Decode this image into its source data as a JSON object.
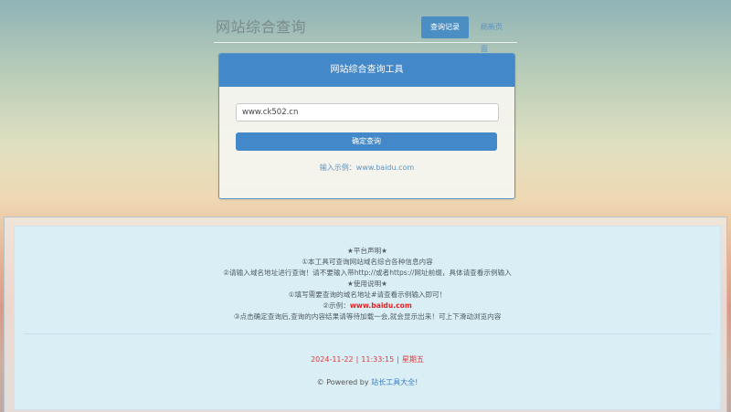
{
  "header": {
    "title": "网站综合查询",
    "history_button": "查询记录",
    "refresh_link": "刷新页面"
  },
  "panel": {
    "title": "网站综合查询工具",
    "input_value": "www.ck502.cn",
    "submit_label": "确定查询",
    "example_text": "输入示例：www.baidu.com"
  },
  "notice": {
    "lines": [
      "★平台声明★",
      "①本工具可查询网站域名综合各种信息内容",
      "②请输入域名地址进行查询！请不要输入带http://或者https://网址前缀，具体请查看示例输入",
      "★使用说明★",
      "①填写需要查询的域名地址#请查看示例输入即可！",
      "",
      "③点击确定查询后,查询的内容结果请等待加载一会,就会显示出来！可上下滑动浏览内容"
    ],
    "example_prefix": "②示例：",
    "example_domain": "www.baidu.com"
  },
  "footer": {
    "date": "2024-11-22",
    "time": "11:33:15",
    "weekday": "星期五",
    "powered_prefix": "© Powered by ",
    "powered_link": "站长工具大全!"
  },
  "colors": {
    "accent": "#4389c9",
    "highlight_red": "#e32222"
  }
}
